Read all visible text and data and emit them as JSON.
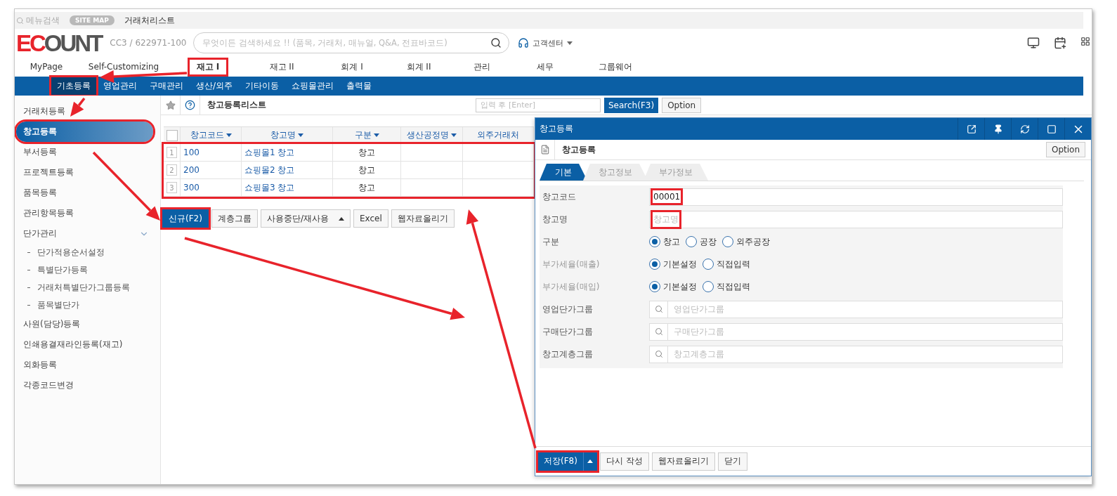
{
  "top_bar": {
    "menu_search": "메뉴검색",
    "site_map": "SITE MAP",
    "breadcrumb": "거래처리스트"
  },
  "header": {
    "logo_accent": "EC",
    "logo_rest": "OUNT",
    "company": "CC3 / 622971-100",
    "search": {
      "placeholder": "무엇이든 검색하세요 !! (품목, 거래처, 매뉴얼, Q&A, 전표바코드)"
    },
    "support": "고객센터"
  },
  "main_menu": [
    {
      "label": "MyPage",
      "selected": false,
      "highlighted": false
    },
    {
      "label": "Self-Customizing",
      "selected": false,
      "highlighted": false
    },
    {
      "label": "재고 I",
      "selected": true,
      "highlighted": true
    },
    {
      "label": "재고 II",
      "selected": false,
      "highlighted": false
    },
    {
      "label": "회계 I",
      "selected": false,
      "highlighted": false
    },
    {
      "label": "회계 II",
      "selected": false,
      "highlighted": false
    },
    {
      "label": "관리",
      "selected": false,
      "highlighted": false
    },
    {
      "label": "세무",
      "selected": false,
      "highlighted": false
    },
    {
      "label": "그룹웨어",
      "selected": false,
      "highlighted": false
    }
  ],
  "sub_menu": [
    {
      "label": "기초등록",
      "selected": true,
      "highlighted": true
    },
    {
      "label": "영업관리",
      "selected": false,
      "highlighted": false
    },
    {
      "label": "구매관리",
      "selected": false,
      "highlighted": false
    },
    {
      "label": "생산/외주",
      "selected": false,
      "highlighted": false
    },
    {
      "label": "기타이동",
      "selected": false,
      "highlighted": false
    },
    {
      "label": "쇼핑몰관리",
      "selected": false,
      "highlighted": false
    },
    {
      "label": "출력물",
      "selected": false,
      "highlighted": false
    }
  ],
  "sidebar": {
    "items": [
      {
        "label": "거래처등록",
        "selected": false,
        "highlighted": false
      },
      {
        "label": "창고등록",
        "selected": true,
        "highlighted": true
      },
      {
        "label": "부서등록",
        "selected": false,
        "highlighted": false
      },
      {
        "label": "프로젝트등록",
        "selected": false,
        "highlighted": false
      },
      {
        "label": "품목등록",
        "selected": false,
        "highlighted": false
      },
      {
        "label": "관리항목등록",
        "selected": false,
        "highlighted": false
      },
      {
        "label": "단가관리",
        "expanded": true,
        "children": [
          {
            "label": "단가적용순서설정",
            "selected": false
          },
          {
            "label": "특별단가등록",
            "selected": false
          },
          {
            "label": "거래처특별단가그룹등록",
            "selected": false
          },
          {
            "label": "품목별단가",
            "selected": false
          }
        ]
      },
      {
        "label": "사원(담당)등록",
        "selected": false,
        "highlighted": false
      },
      {
        "label": "인쇄용결재라인등록(재고)",
        "selected": false,
        "highlighted": false
      },
      {
        "label": "외화등록",
        "selected": false,
        "highlighted": false
      },
      {
        "label": "각종코드변경",
        "selected": false,
        "highlighted": false
      }
    ]
  },
  "list": {
    "title": "창고등록리스트",
    "search": {
      "placeholder": "입력 후 [Enter]"
    },
    "search_button": "Search(F3)",
    "option_button": "Option",
    "table": {
      "columns": [
        {
          "label": "창고코드",
          "sortable": true
        },
        {
          "label": "창고명",
          "sortable": true
        },
        {
          "label": "구분",
          "sortable": true
        },
        {
          "label": "생산공정명",
          "sortable": true
        },
        {
          "label": "외주거래처",
          "sortable": false
        }
      ],
      "rows_highlighted": true,
      "all_checked": false,
      "rows": [
        {
          "number": "1",
          "code": "100",
          "name": "쇼핑몰1 창고",
          "type": "창고"
        },
        {
          "number": "2",
          "code": "200",
          "name": "쇼핑몰2 창고",
          "type": "창고"
        },
        {
          "number": "3",
          "code": "300",
          "name": "쇼핑몰3 창고",
          "type": "창고"
        }
      ]
    },
    "buttons": [
      {
        "label": "신규(F2)",
        "kind": "primary",
        "highlighted": true
      },
      {
        "label": "계층그룹",
        "kind": "plain",
        "highlighted": false
      },
      {
        "label": "사용중단/재사용",
        "kind": "dropdown",
        "highlighted": false
      },
      {
        "label": "Excel",
        "kind": "plain",
        "highlighted": false
      },
      {
        "label": "웹자료올리기",
        "kind": "plain",
        "highlighted": false
      }
    ]
  },
  "dialog": {
    "title": "창고등록",
    "heading": "창고등록",
    "option_button": "Option",
    "tabs": [
      {
        "label": "기본",
        "selected": true
      },
      {
        "label": "창고정보",
        "selected": false
      },
      {
        "label": "부가정보",
        "selected": false
      }
    ],
    "fields": [
      {
        "kind": "text",
        "label": "창고코드",
        "value": "00001",
        "dimmed": false,
        "highlighted": true
      },
      {
        "kind": "text",
        "label": "창고명",
        "placeholder": "창고명",
        "dimmed": false,
        "highlighted": true
      },
      {
        "kind": "radio",
        "label": "구분",
        "dimmed": false,
        "options": [
          {
            "label": "창고",
            "selected": true
          },
          {
            "label": "공장",
            "selected": false
          },
          {
            "label": "외주공장",
            "selected": false
          }
        ]
      },
      {
        "kind": "radio",
        "label": "부가세율(매출)",
        "dimmed": true,
        "options": [
          {
            "label": "기본설정",
            "selected": true
          },
          {
            "label": "직접입력",
            "selected": false
          }
        ]
      },
      {
        "kind": "radio",
        "label": "부가세율(매입)",
        "dimmed": true,
        "options": [
          {
            "label": "기본설정",
            "selected": true
          },
          {
            "label": "직접입력",
            "selected": false
          }
        ]
      },
      {
        "kind": "search",
        "label": "영업단가그룹",
        "placeholder": "영업단가그룹",
        "dimmed": false
      },
      {
        "kind": "search",
        "label": "구매단가그룹",
        "placeholder": "구매단가그룹",
        "dimmed": false
      },
      {
        "kind": "search",
        "label": "창고계층그룹",
        "placeholder": "창고계층그룹",
        "dimmed": false
      }
    ],
    "buttons": [
      {
        "label": "저장(F8)",
        "kind": "primary_split",
        "highlighted": true
      },
      {
        "label": "다시 작성",
        "kind": "plain",
        "highlighted": false
      },
      {
        "label": "웹자료올리기",
        "kind": "plain",
        "highlighted": false
      },
      {
        "label": "닫기",
        "kind": "plain",
        "highlighted": false
      }
    ]
  }
}
